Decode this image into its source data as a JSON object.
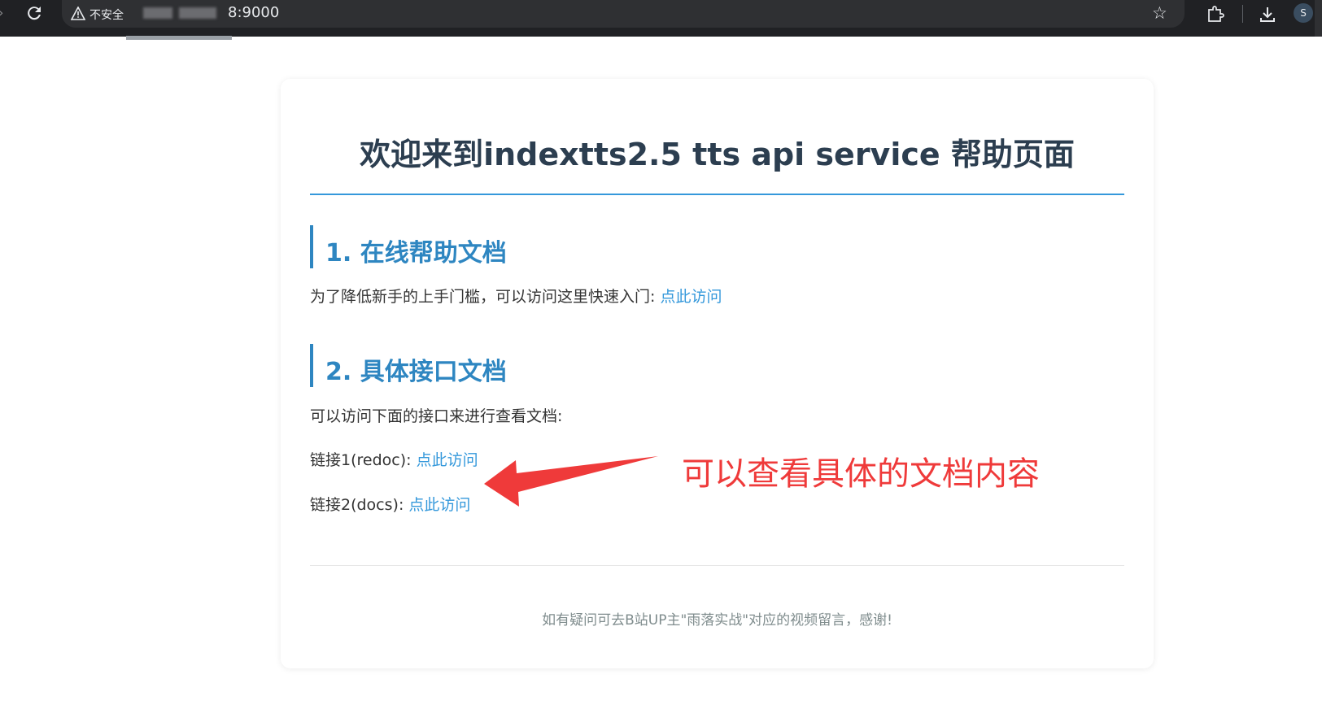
{
  "browser": {
    "security_label": "不安全",
    "url_visible": "8:9000",
    "avatar_letter": "S",
    "icons": {
      "reload": "reload-icon",
      "warning": "warning-triangle-icon",
      "bookmark": "star-icon",
      "extensions": "puzzle-icon",
      "download": "download-icon"
    }
  },
  "page": {
    "title": "欢迎来到indextts2.5 tts api service 帮助页面",
    "section1": {
      "heading": "1. 在线帮助文档",
      "text": "为了降低新手的上手门槛，可以访问这里快速入门: ",
      "link": "点此访问"
    },
    "section2": {
      "heading": "2. 具体接口文档",
      "intro": "可以访问下面的接口来进行查看文档:",
      "link1_label": "链接1(redoc): ",
      "link1_text": "点此访问",
      "link2_label": "链接2(docs): ",
      "link2_text": "点此访问"
    },
    "footer": "如有疑问可去B站UP主\"雨落实战\"对应的视频留言，感谢!"
  },
  "annotation": {
    "text": "可以查看具体的文档内容",
    "color": "#ef3a3a"
  },
  "colors": {
    "accent": "#3498db",
    "heading": "#2e86c1",
    "title": "#2c3e50"
  }
}
